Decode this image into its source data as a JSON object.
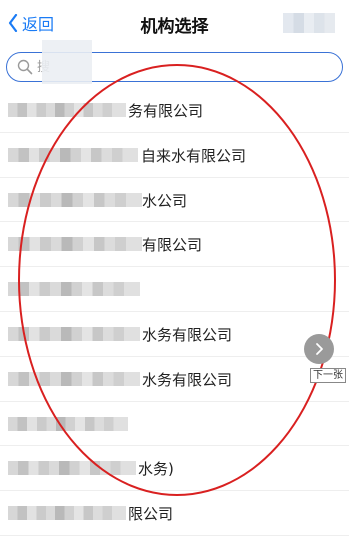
{
  "nav": {
    "back_label": "返回",
    "title": "机构选择"
  },
  "search": {
    "placeholder": "搜"
  },
  "list": {
    "items": [
      {
        "text": "务有限公司"
      },
      {
        "text": "自来水有限公司"
      },
      {
        "text": "水公司"
      },
      {
        "text": "有限公司"
      },
      {
        "text": ""
      },
      {
        "text": "水务有限公司"
      },
      {
        "text": "水务有限公司"
      },
      {
        "text": ""
      },
      {
        "text": "水务)"
      },
      {
        "text": "限公司"
      }
    ]
  },
  "overlay": {
    "next_label": "下一张"
  },
  "colors": {
    "accent": "#1a7bf5",
    "annotation": "#d92020"
  },
  "icons": {
    "back": "chevron-left-icon",
    "search": "search-icon",
    "next": "chevron-right-icon"
  }
}
